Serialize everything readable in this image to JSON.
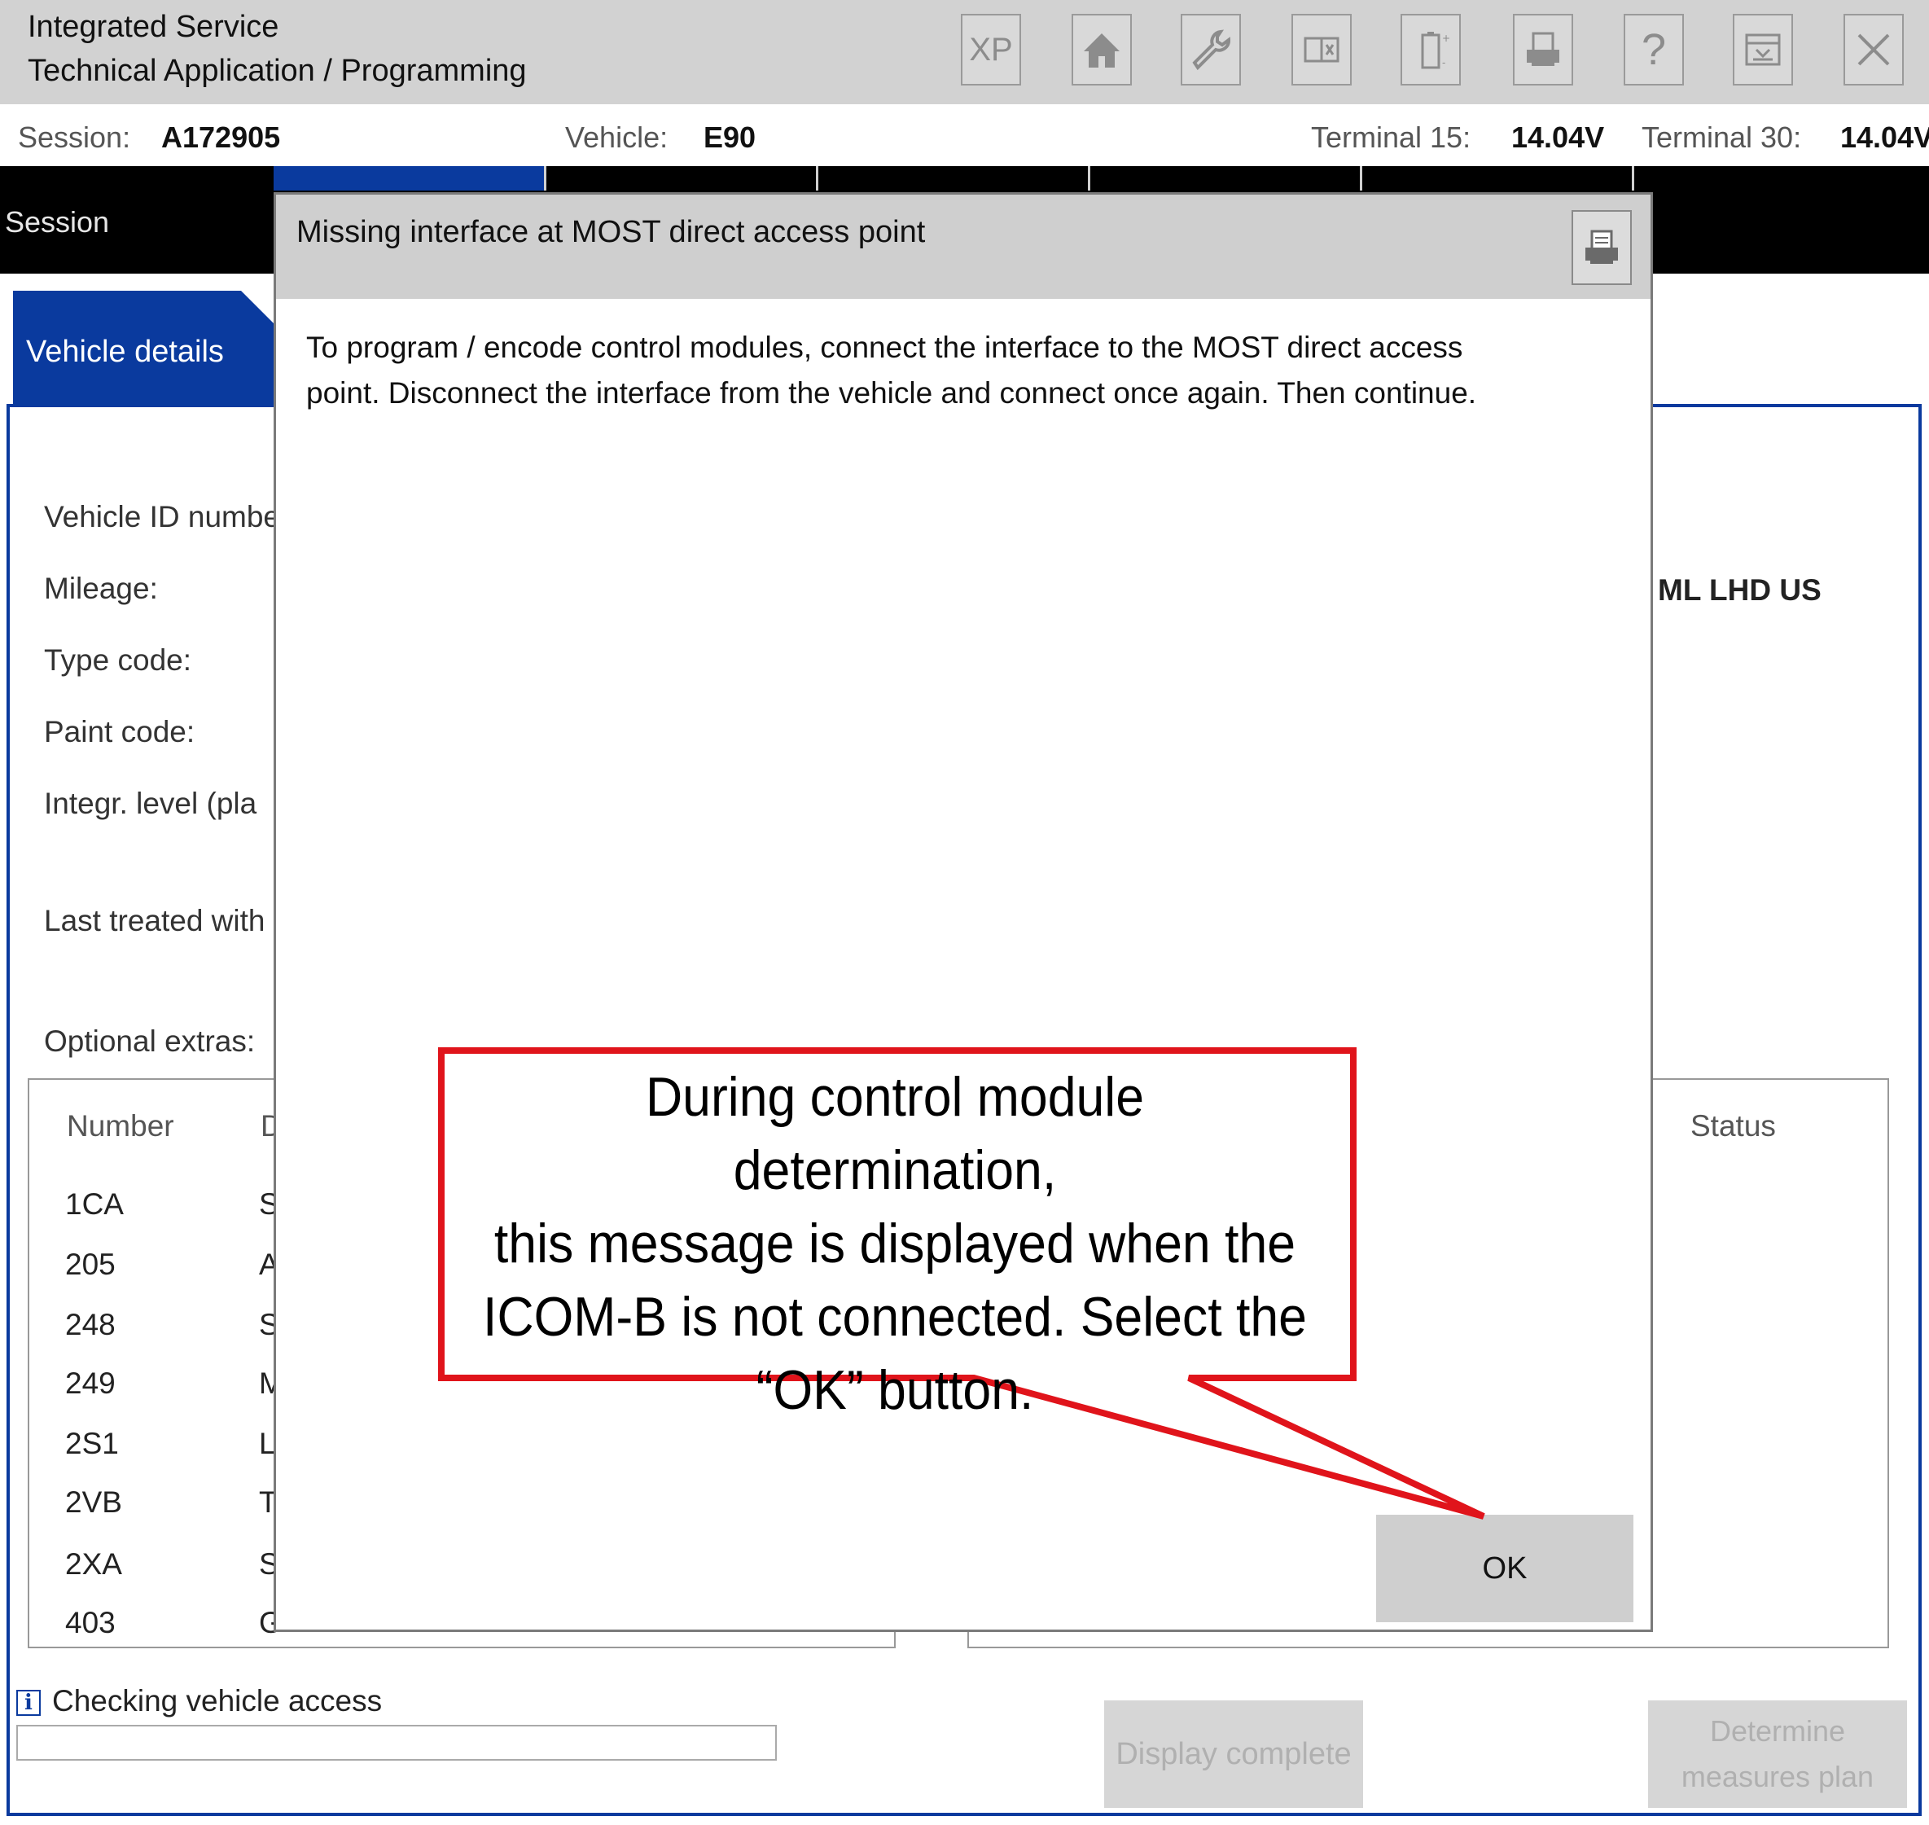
{
  "app": {
    "title_line1": "Integrated Service",
    "title_line2": "Technical Application / Programming"
  },
  "toolbar": {
    "buttons": [
      {
        "icon": "xp-icon",
        "label": "XP"
      },
      {
        "icon": "home-icon"
      },
      {
        "icon": "wrench-icon"
      },
      {
        "icon": "split-view-icon"
      },
      {
        "icon": "battery-icon"
      },
      {
        "icon": "printer-icon"
      },
      {
        "icon": "help-icon",
        "label": "?"
      },
      {
        "icon": "download-icon"
      },
      {
        "icon": "close-icon"
      }
    ]
  },
  "info": {
    "session_label": "Session:",
    "session_value": "A172905",
    "vehicle_label": "Vehicle:",
    "vehicle_value": "E90",
    "t15_label": "Terminal 15:",
    "t15_value": "14.04V",
    "t30_label": "Terminal 30:",
    "t30_value": "14.04V"
  },
  "tabs": {
    "session_label": "Session"
  },
  "vehicle_panel": {
    "subtab_label": "Vehicle details",
    "fields": [
      "Vehicle ID numbe",
      "Mileage:",
      "Type code:",
      "Paint code:",
      "Integr. level (pla",
      "Last treated with",
      "Optional extras:"
    ],
    "right_fragment": "ML LHD US"
  },
  "extras_table": {
    "col_number": "Number",
    "col_desc": "D",
    "col_status": "Status",
    "rows": [
      {
        "number": "1CA",
        "desc": "S"
      },
      {
        "number": "205",
        "desc": "A"
      },
      {
        "number": "248",
        "desc": "S"
      },
      {
        "number": "249",
        "desc": "M"
      },
      {
        "number": "2S1",
        "desc": "L"
      },
      {
        "number": "2VB",
        "desc": "T"
      },
      {
        "number": "2XA",
        "desc": "S"
      },
      {
        "number": "403",
        "desc": "G"
      }
    ]
  },
  "status": {
    "text": "Checking vehicle access",
    "progress": 0
  },
  "bottom_buttons": {
    "display_complete": "Display complete",
    "determine_line1": "Determine",
    "determine_line2": "measures plan"
  },
  "dialog": {
    "title": "Missing interface at MOST direct access point",
    "message_line1": "To program / encode control modules, connect the interface to the MOST direct access",
    "message_line2": "point. Disconnect the interface from the vehicle and connect once again. Then continue.",
    "ok_label": "OK"
  },
  "callout": {
    "line1": "During control module determination,",
    "line2": "this message is displayed when the",
    "line3": "ICOM-B is not connected. Select the",
    "line4": "“OK” button.",
    "color": "#e0141b"
  },
  "colors": {
    "accent_blue": "#0a3a9e",
    "titlebar_gray": "#d2d2d2"
  }
}
